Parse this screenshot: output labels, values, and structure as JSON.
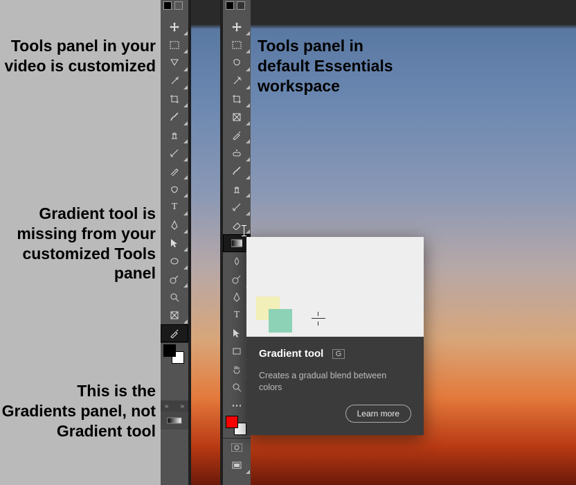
{
  "annotations": {
    "a1": "Tools panel in your video is customized",
    "a2": "Gradient tool is missing from your customized Tools panel",
    "a3": "This is the Gradients panel, not Gradient tool",
    "a4": "Tools panel in default Essentials workspace"
  },
  "tooltip": {
    "title": "Gradient tool",
    "shortcut": "G",
    "desc": "Creates a gradual blend between colors",
    "learn_more": "Learn more"
  },
  "left_tools": [
    "move-tool",
    "rectangular-marquee-tool",
    "lasso-tool",
    "magic-wand-tool",
    "crop-tool",
    "frame-tool",
    "eyedropper-tool",
    "brush-tool",
    "clone-stamp-tool",
    "history-brush-tool",
    "pencil-tool",
    "smudge-tool",
    "type-tool",
    "pen-tool",
    "path-selection-tool",
    "ellipse-tool",
    "blur-tool",
    "zoom-tool",
    "frame-tool-alt",
    "color-sampler-tool"
  ],
  "right_tools": [
    "move-tool",
    "rectangular-marquee-tool",
    "lasso-tool",
    "magic-wand-tool",
    "crop-tool",
    "frame-tool",
    "eyedropper-tool",
    "spot-healing-brush-tool",
    "ruler-tool",
    "brush-tool",
    "clone-stamp-tool",
    "history-brush-tool",
    "eraser-tool",
    "gradient-tool",
    "smudge-tool",
    "dodge-tool",
    "pen-tool",
    "type-tool",
    "path-selection-tool",
    "shape-tool",
    "hand-tool",
    "zoom-tool"
  ],
  "colors": {
    "left_fg": "#000000",
    "left_bg": "#ffffff",
    "right_fg": "#ff0000",
    "right_bg": "#ffffff"
  }
}
